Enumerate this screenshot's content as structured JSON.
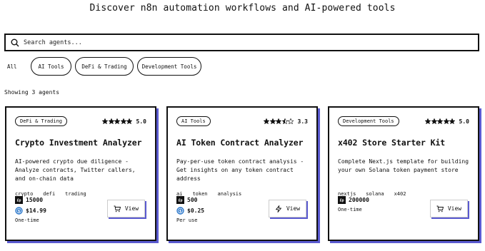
{
  "header": {
    "title": "Discover n8n automation workflows and AI-powered tools"
  },
  "search": {
    "placeholder": "Search agents..."
  },
  "filters": [
    "All",
    "AI Tools",
    "DeFi & Trading",
    "Development Tools"
  ],
  "results": {
    "count_text": "Showing 3 agents"
  },
  "colors": {
    "accent_shadow": "#5a5ad0",
    "border": "#111111"
  },
  "cards": [
    {
      "category": "DeFi & Trading",
      "rating": "5.0",
      "stars": 5,
      "title": "Crypto Investment Analyzer",
      "description": "AI-powered crypto due diligence - Analyze contracts, Twitter callers, and on-chain data",
      "keywords": [
        "crypto",
        "defi",
        "trading"
      ],
      "tokens": "15000",
      "price": "$14.99",
      "pricing_note": "One-time",
      "action_label": "View",
      "action_icon": "cart-icon"
    },
    {
      "category": "AI Tools",
      "rating": "3.3",
      "stars": 3.3,
      "title": "AI Token Contract Analyzer",
      "description": "Pay-per-use token contract analysis - Get insights on any token contract address",
      "keywords": [
        "ai",
        "token",
        "analysis"
      ],
      "tokens": "500",
      "price": "$0.25",
      "pricing_note": "Per use",
      "action_label": "View",
      "action_icon": "lightning-icon"
    },
    {
      "category": "Development Tools",
      "rating": "5.0",
      "stars": 5,
      "title": "x402 Store Starter Kit",
      "description": "Complete Next.js template for building your own Solana token payment store",
      "keywords": [
        "nextjs",
        "solana",
        "x402"
      ],
      "tokens": "200000",
      "price": "",
      "pricing_note": "One-time",
      "action_label": "View",
      "action_icon": "cart-icon"
    }
  ]
}
